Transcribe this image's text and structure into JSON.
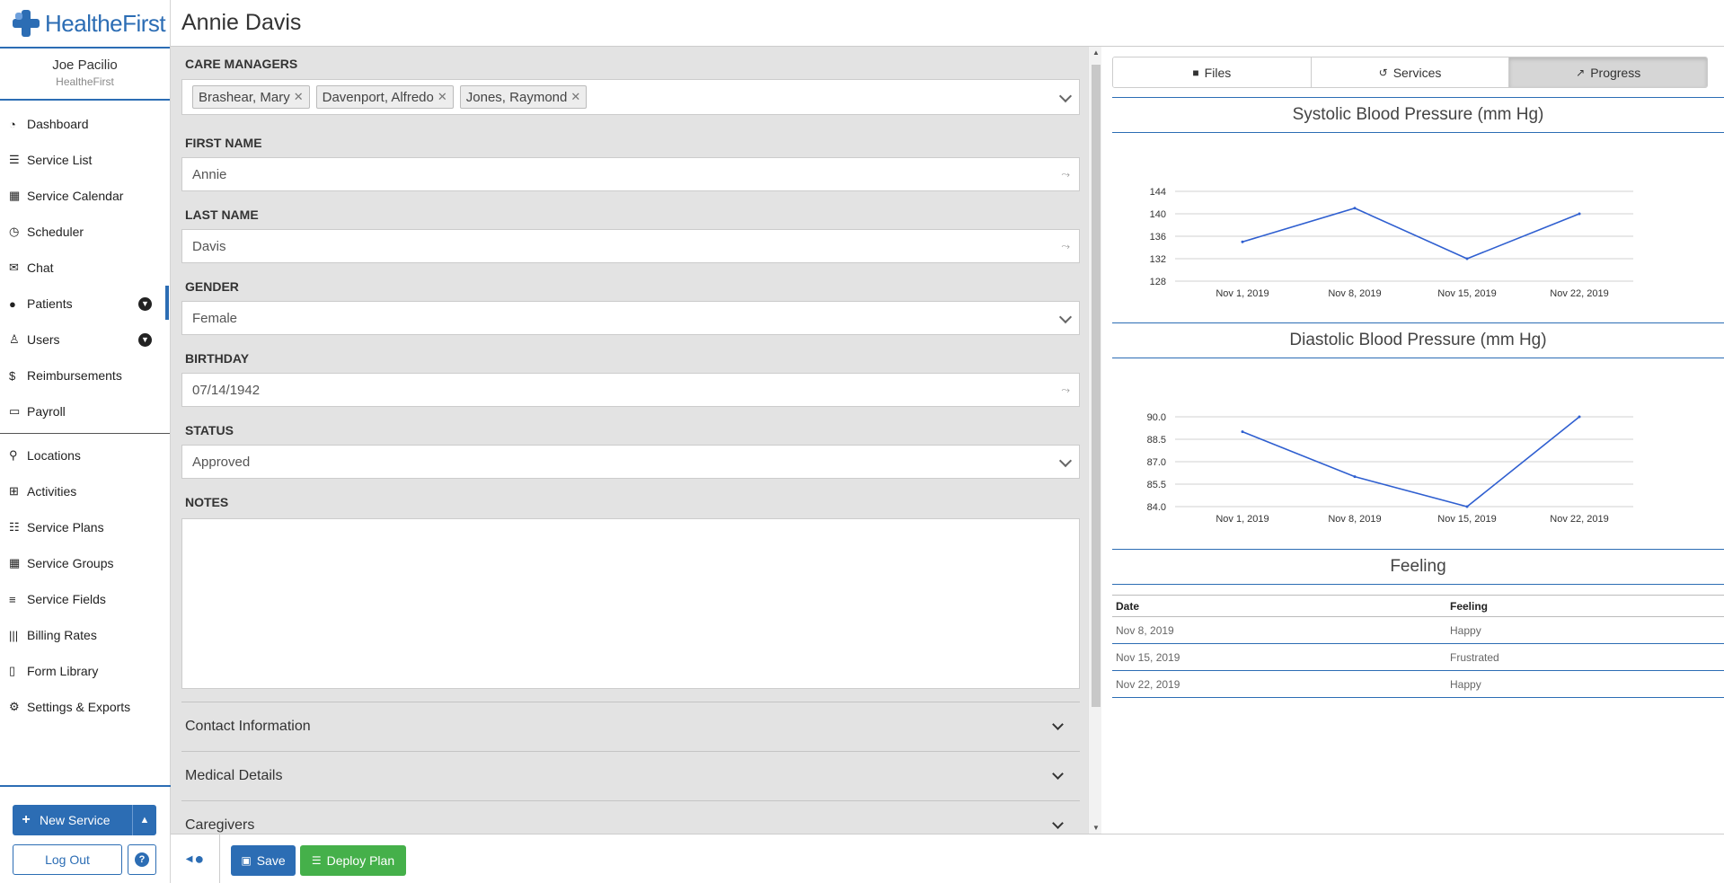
{
  "app": {
    "brand": "HealtheFirst"
  },
  "user": {
    "name": "Joe Pacilio",
    "org": "HealtheFirst"
  },
  "nav": {
    "main": [
      {
        "label": "Dashboard",
        "icon": "dashboard-icon"
      },
      {
        "label": "Service List",
        "icon": "list-icon"
      },
      {
        "label": "Service Calendar",
        "icon": "calendar-icon"
      },
      {
        "label": "Scheduler",
        "icon": "clock-icon"
      },
      {
        "label": "Chat",
        "icon": "chat-icon"
      },
      {
        "label": "Patients",
        "icon": "user-icon"
      },
      {
        "label": "Users",
        "icon": "user-tie-icon"
      },
      {
        "label": "Reimbursements",
        "icon": "dollar-icon"
      },
      {
        "label": "Payroll",
        "icon": "money-icon"
      }
    ],
    "secondary": [
      {
        "label": "Locations",
        "icon": "map-marker-icon"
      },
      {
        "label": "Activities",
        "icon": "first-aid-icon"
      },
      {
        "label": "Service Plans",
        "icon": "list-ol-icon"
      },
      {
        "label": "Service Groups",
        "icon": "grid-icon"
      },
      {
        "label": "Service Fields",
        "icon": "bars-icon"
      },
      {
        "label": "Billing Rates",
        "icon": "barcode-icon"
      },
      {
        "label": "Form Library",
        "icon": "file-icon"
      },
      {
        "label": "Settings & Exports",
        "icon": "cogs-icon"
      }
    ],
    "new_service": "New Service",
    "logout": "Log Out",
    "help": "?"
  },
  "header": {
    "title": "Annie Davis"
  },
  "form": {
    "care_managers_label": "CARE MANAGERS",
    "care_managers": [
      "Brashear, Mary",
      "Davenport, Alfredo",
      "Jones, Raymond"
    ],
    "first_name_label": "FIRST NAME",
    "first_name": "Annie",
    "last_name_label": "LAST NAME",
    "last_name": "Davis",
    "gender_label": "GENDER",
    "gender": "Female",
    "birthday_label": "BIRTHDAY",
    "birthday": "07/14/1942",
    "status_label": "STATUS",
    "status": "Approved",
    "notes_label": "NOTES",
    "notes": "",
    "sections": [
      "Contact Information",
      "Medical Details",
      "Caregivers"
    ]
  },
  "tabs": [
    {
      "label": "Files",
      "icon": "folder-icon"
    },
    {
      "label": "Services",
      "icon": "history-icon"
    },
    {
      "label": "Progress",
      "icon": "chart-line-icon"
    }
  ],
  "progress": {
    "feeling_title": "Feeling",
    "feeling_columns": [
      "Date",
      "Feeling"
    ],
    "feeling_rows": [
      [
        "Nov 8, 2019",
        "Happy"
      ],
      [
        "Nov 15, 2019",
        "Frustrated"
      ],
      [
        "Nov 22, 2019",
        "Happy"
      ]
    ]
  },
  "footer": {
    "save": "Save",
    "deploy": "Deploy Plan"
  },
  "colors": {
    "primary": "#2c6db4",
    "success": "#45b04a",
    "line": "#2f5fd0"
  },
  "chart_data": [
    {
      "type": "line",
      "title": "Systolic Blood Pressure (mm Hg)",
      "categories": [
        "Nov 1, 2019",
        "Nov 8, 2019",
        "Nov 15, 2019",
        "Nov 22, 2019"
      ],
      "values": [
        135,
        141,
        132,
        140
      ],
      "yticks": [
        128,
        132,
        136,
        140,
        144
      ],
      "ylim": [
        128,
        144
      ],
      "grid": true
    },
    {
      "type": "line",
      "title": "Diastolic Blood Pressure (mm Hg)",
      "categories": [
        "Nov 1, 2019",
        "Nov 8, 2019",
        "Nov 15, 2019",
        "Nov 22, 2019"
      ],
      "values": [
        89,
        86,
        84,
        90
      ],
      "yticks": [
        "84.0",
        "85.5",
        "87.0",
        "88.5",
        "90.0"
      ],
      "ylim": [
        84,
        90
      ],
      "grid": true
    }
  ]
}
